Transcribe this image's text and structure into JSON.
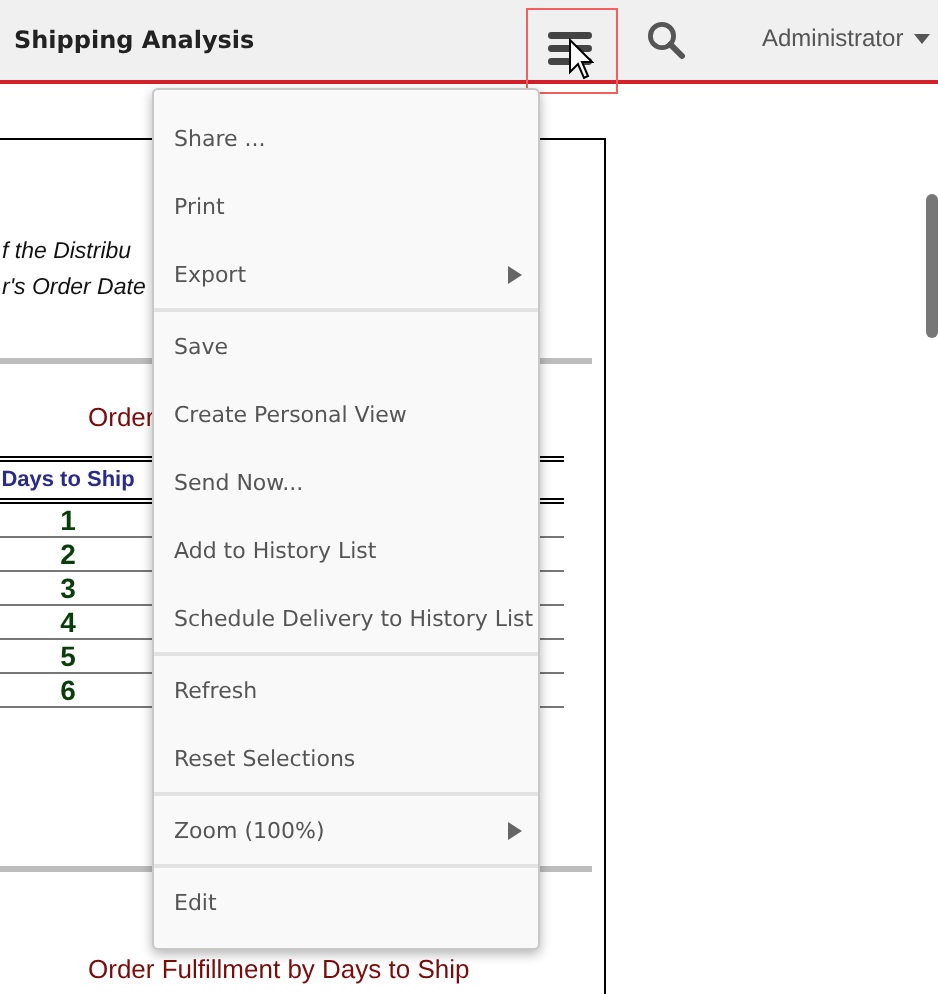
{
  "header": {
    "title": "Shipping Analysis",
    "user": "Administrator"
  },
  "report": {
    "subtitle_lines": [
      "f the Distribu",
      "r's Order Date"
    ],
    "section_title": "Order",
    "column_header": "Days to Ship",
    "rows": [
      "1",
      "2",
      "3",
      "4",
      "5",
      "6"
    ],
    "second_section_title": "Order Fulfillment by Days to Ship"
  },
  "menu": [
    {
      "label": "Share ...",
      "has_submenu": false,
      "separator_after": false
    },
    {
      "label": "Print",
      "has_submenu": false,
      "separator_after": false
    },
    {
      "label": "Export",
      "has_submenu": true,
      "separator_after": true
    },
    {
      "label": "Save",
      "has_submenu": false,
      "separator_after": false
    },
    {
      "label": "Create Personal View",
      "has_submenu": false,
      "separator_after": false
    },
    {
      "label": "Send Now...",
      "has_submenu": false,
      "separator_after": false
    },
    {
      "label": "Add to History List",
      "has_submenu": false,
      "separator_after": false
    },
    {
      "label": "Schedule Delivery to History List",
      "has_submenu": false,
      "separator_after": true
    },
    {
      "label": "Refresh",
      "has_submenu": false,
      "separator_after": false
    },
    {
      "label": "Reset Selections",
      "has_submenu": false,
      "separator_after": true
    },
    {
      "label": "Zoom (100%)",
      "has_submenu": true,
      "separator_after": true
    },
    {
      "label": "Edit",
      "has_submenu": false,
      "separator_after": false
    }
  ]
}
